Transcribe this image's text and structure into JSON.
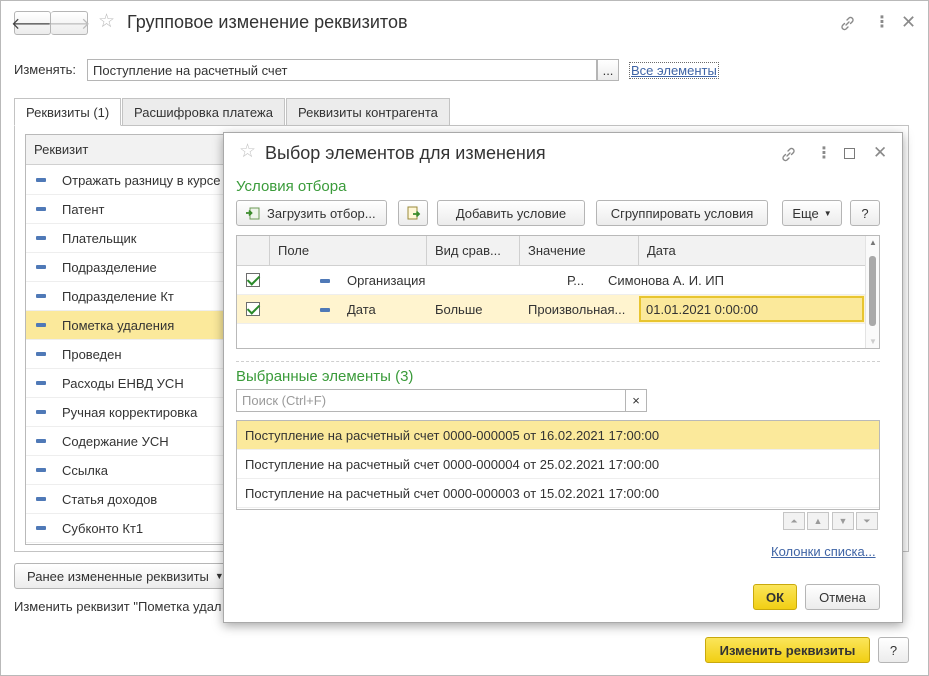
{
  "window": {
    "title": "Групповое изменение реквизитов",
    "change_label": "Изменять:",
    "change_value": "Поступление на расчетный счет",
    "ellipsis": "...",
    "all_elements_link": "Все элементы",
    "tabs": [
      "Реквизиты (1)",
      "Расшифровка платежа",
      "Реквизиты контрагента"
    ],
    "grid_header": "Реквизит",
    "attributes": [
      "Отражать разницу в курсе",
      "Патент",
      "Плательщик",
      "Подразделение",
      "Подразделение Кт",
      "Пометка удаления",
      "Проведен",
      "Расходы ЕНВД УСН",
      "Ручная корректировка",
      "Содержание УСН",
      "Ссылка",
      "Статья доходов",
      "Субконто Кт1"
    ],
    "selected_attribute_index": 5,
    "previously_changed_button": "Ранее измененные реквизиты",
    "status_text": "Изменить реквизит \"Пометка удал",
    "apply_button": "Изменить реквизиты",
    "help_button": "?"
  },
  "dialog": {
    "title": "Выбор элементов для изменения",
    "filter_section": "Условия отбора",
    "toolbar": {
      "load_filter": "Загрузить отбор...",
      "add_condition": "Добавить условие",
      "group_conditions": "Сгруппировать условия",
      "more": "Еще",
      "help": "?"
    },
    "filter_columns": [
      "Поле",
      "Вид срав...",
      "Значение",
      "Дата"
    ],
    "filter_rows": [
      {
        "checked": true,
        "field": "Организация",
        "comparison": "",
        "value": "Р...",
        "extra": "Симонова А. И. ИП"
      },
      {
        "checked": true,
        "field": "Дата",
        "comparison": "Больше",
        "value": "Произвольная...",
        "extra": "01.01.2021 0:00:00"
      }
    ],
    "selected_section": "Выбранные элементы (3)",
    "search_placeholder": "Поиск (Ctrl+F)",
    "clear_search": "×",
    "documents": [
      "Поступление на расчетный счет 0000-000005 от 16.02.2021 17:00:00",
      "Поступление на расчетный счет 0000-000004 от 25.02.2021 17:00:00",
      "Поступление на расчетный счет 0000-000003 от 15.02.2021 17:00:00"
    ],
    "list_columns_link": "Колонки списка...",
    "ok_button": "ОК",
    "cancel_button": "Отмена"
  },
  "colors": {
    "accent_yellow": "#f4d32d",
    "selection_yellow": "#fbe99b",
    "section_green": "#3a9b3a",
    "link_blue": "#3f64a5",
    "bullet_blue": "#4f79b7"
  }
}
